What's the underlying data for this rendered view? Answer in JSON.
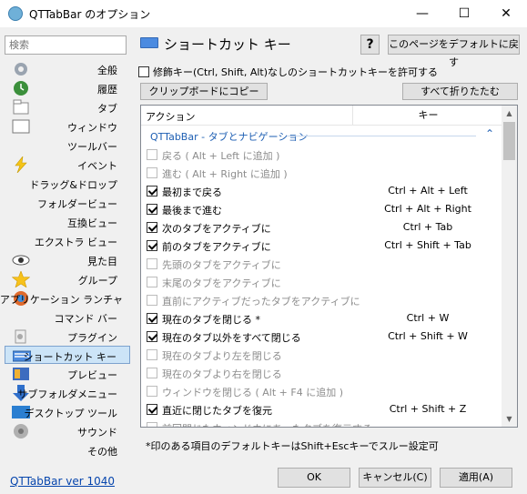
{
  "window": {
    "title": "QTTabBar のオプション",
    "minimize": "—",
    "maximize": "☐",
    "close": "✕"
  },
  "sidebar": {
    "search_placeholder": "検索",
    "items": [
      {
        "label": "全般",
        "icon": "gear-icon"
      },
      {
        "label": "履歴",
        "icon": "history-icon"
      },
      {
        "label": "タブ",
        "icon": "tab-icon"
      },
      {
        "label": "ウィンドウ",
        "icon": "window-icon"
      },
      {
        "label": "ツールバー",
        "icon": "toolbar-icon"
      },
      {
        "label": "イベント",
        "icon": "lightning-icon"
      },
      {
        "label": "ドラッグ&ドロップ",
        "icon": "drag-drop-icon"
      },
      {
        "label": "フォルダービュー",
        "icon": "folder-view-icon"
      },
      {
        "label": "互換ビュー",
        "icon": "compat-view-icon"
      },
      {
        "label": "エクストラ ビュー",
        "icon": "extra-view-icon"
      },
      {
        "label": "見た目",
        "icon": "eye-icon"
      },
      {
        "label": "グループ",
        "icon": "star-icon"
      },
      {
        "label": "アプリケーション ランチャ",
        "icon": "launcher-icon"
      },
      {
        "label": "コマンド バー",
        "icon": "command-bar-icon"
      },
      {
        "label": "プラグイン",
        "icon": "plugin-icon"
      },
      {
        "label": "ショートカット キー",
        "icon": "keyboard-icon"
      },
      {
        "label": "プレビュー",
        "icon": "preview-icon"
      },
      {
        "label": "サブフォルダメニュー",
        "icon": "subfolder-arrow-icon"
      },
      {
        "label": "デスクトップ ツール",
        "icon": "desktop-icon"
      },
      {
        "label": "サウンド",
        "icon": "speaker-icon"
      },
      {
        "label": "その他",
        "icon": ""
      }
    ],
    "active_index": 15
  },
  "main": {
    "title": "ショートカット キー",
    "help_button": "?",
    "reset_button": "このページをデフォルトに戻す",
    "allow_label": "修飾キー(Ctrl, Shift, Alt)なしのショートカットキーを許可する",
    "copy_button": "クリップボードにコピー",
    "collapse_button": "すべて折りたたむ",
    "col_action": "アクション",
    "col_key": "キー",
    "group_label": "QTTabBar - タブとナビゲーション",
    "group_chevron": "⌃",
    "rows": [
      {
        "action": "戻る ( Alt + Left に追加 )",
        "key": "",
        "checked": false,
        "disabled": true
      },
      {
        "action": "進む ( Alt + Right に追加 )",
        "key": "",
        "checked": false,
        "disabled": true
      },
      {
        "action": "最初まで戻る",
        "key": "Ctrl + Alt + Left",
        "checked": true,
        "disabled": false
      },
      {
        "action": "最後まで進む",
        "key": "Ctrl + Alt + Right",
        "checked": true,
        "disabled": false
      },
      {
        "action": "次のタブをアクティブに",
        "key": "Ctrl + Tab",
        "checked": true,
        "disabled": false
      },
      {
        "action": "前のタブをアクティブに",
        "key": "Ctrl + Shift + Tab",
        "checked": true,
        "disabled": false
      },
      {
        "action": "先頭のタブをアクティブに",
        "key": "",
        "checked": false,
        "disabled": true
      },
      {
        "action": "末尾のタブをアクティブに",
        "key": "",
        "checked": false,
        "disabled": true
      },
      {
        "action": "直前にアクティブだったタブをアクティブに",
        "key": "",
        "checked": false,
        "disabled": true
      },
      {
        "action": "現在のタブを閉じる *",
        "key": "Ctrl + W",
        "checked": true,
        "disabled": false
      },
      {
        "action": "現在のタブ以外をすべて閉じる",
        "key": "Ctrl + Shift + W",
        "checked": true,
        "disabled": false
      },
      {
        "action": "現在のタブより左を閉じる",
        "key": "",
        "checked": false,
        "disabled": true
      },
      {
        "action": "現在のタブより右を閉じる",
        "key": "",
        "checked": false,
        "disabled": true
      },
      {
        "action": "ウィンドウを閉じる ( Alt + F4 に追加 )",
        "key": "",
        "checked": false,
        "disabled": true
      },
      {
        "action": "直近に閉じたタブを復元",
        "key": "Ctrl + Shift + Z",
        "checked": true,
        "disabled": false
      },
      {
        "action": "前回閉じたウィンドウにあったタブを復元する",
        "key": "",
        "checked": false,
        "disabled": true
      }
    ],
    "footnote": "*印のある項目のデフォルトキーはShift+Escキーでスルー設定可"
  },
  "bottom": {
    "version_link": "QTTabBar ver 1040",
    "ok_button": "OK",
    "cancel_button": "キャンセル(C)",
    "apply_button": "適用(A)"
  }
}
